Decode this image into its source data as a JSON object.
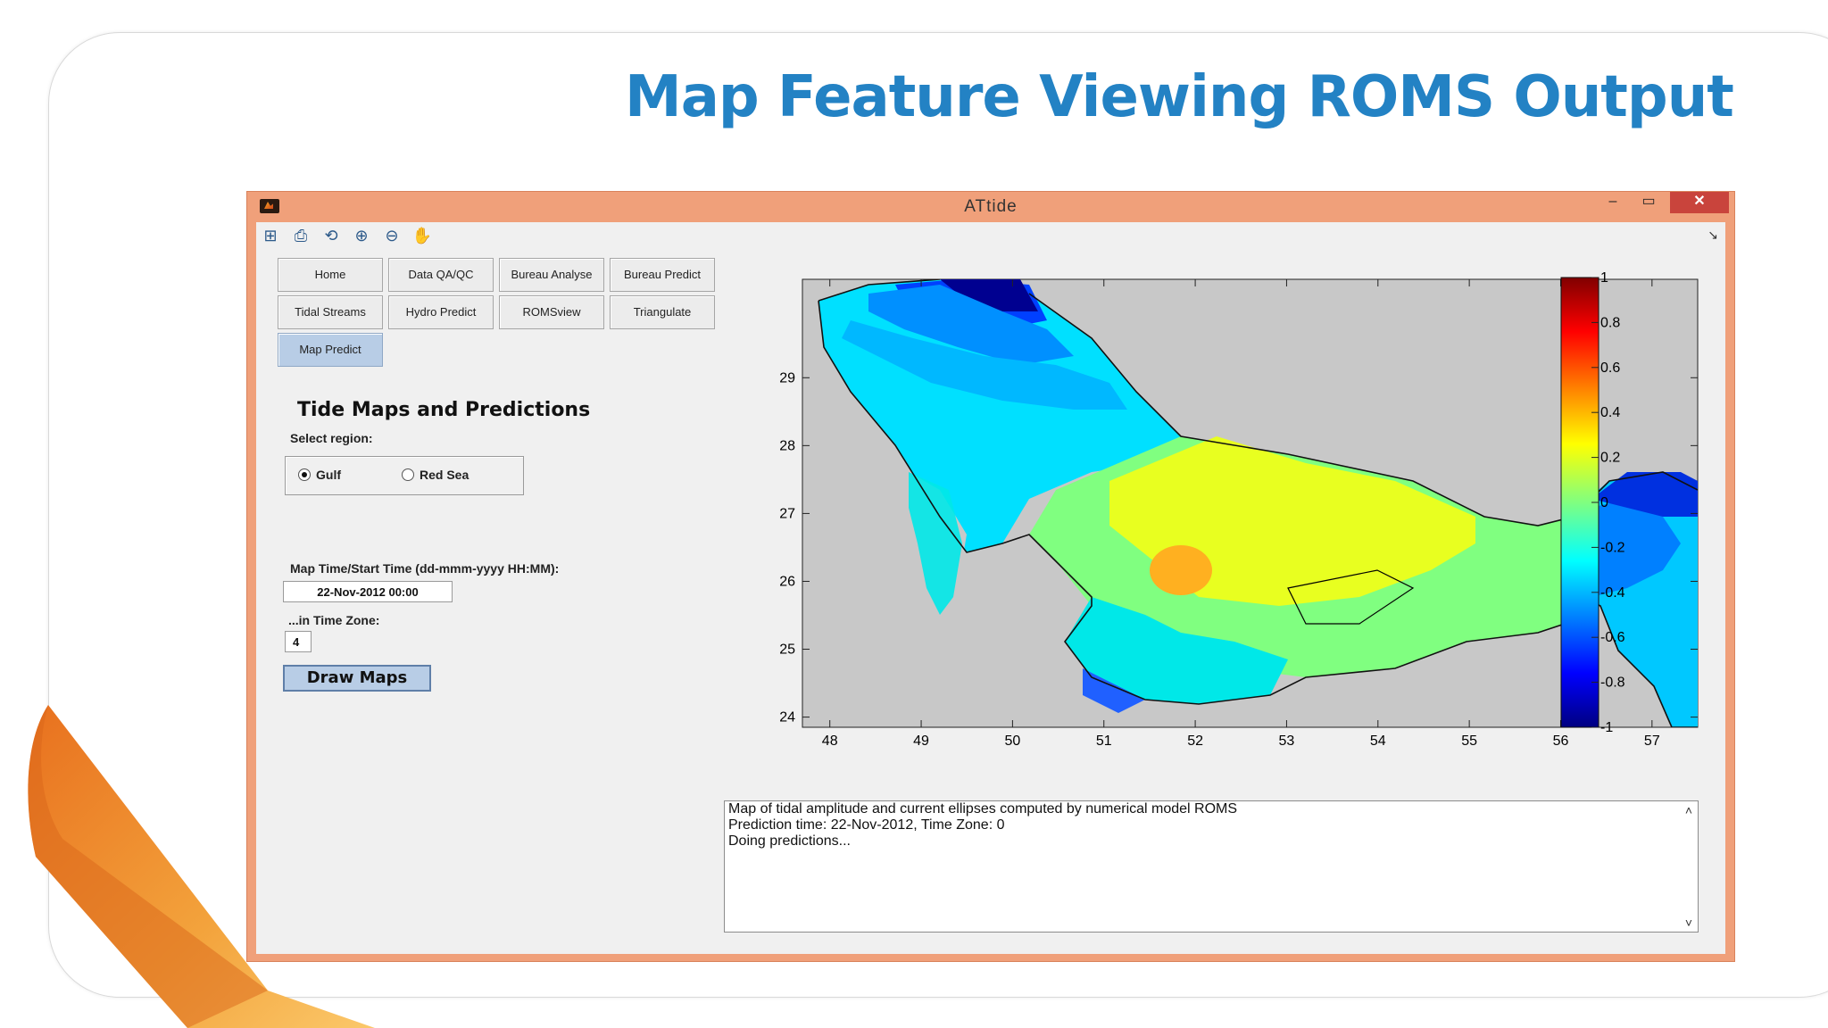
{
  "slide": {
    "title": "Map Feature Viewing ROMS Output"
  },
  "window": {
    "title": "ATtide",
    "minimize": "–",
    "maximize": "▭",
    "close": "✕",
    "dock": "↘"
  },
  "toolbar": {
    "icons": [
      "new-figure-icon",
      "print-icon",
      "rotate-icon",
      "zoom-in-icon",
      "zoom-out-icon",
      "pan-hand-icon"
    ]
  },
  "nav": {
    "buttons": [
      {
        "label": "Home"
      },
      {
        "label": "Data QA/QC"
      },
      {
        "label": "Bureau Analyse"
      },
      {
        "label": "Bureau Predict"
      },
      {
        "label": "Tidal Streams"
      },
      {
        "label": "Hydro Predict"
      },
      {
        "label": "ROMSview"
      },
      {
        "label": "Triangulate"
      },
      {
        "label": "Map Predict",
        "active": true
      }
    ]
  },
  "panel": {
    "title": "Tide Maps and Predictions",
    "region_label": "Select region:",
    "regions": [
      {
        "label": "Gulf",
        "selected": true
      },
      {
        "label": "Red Sea",
        "selected": false
      }
    ],
    "time_label": "Map Time/Start Time (dd-mmm-yyyy HH:MM):",
    "time_value": "22-Nov-2012 00:00",
    "tz_label": "...in Time Zone:",
    "tz_value": "4",
    "draw_button": "Draw Maps"
  },
  "map": {
    "x_ticks": [
      "48",
      "49",
      "50",
      "51",
      "52",
      "53",
      "54",
      "55",
      "56",
      "57"
    ],
    "y_ticks": [
      "24",
      "25",
      "26",
      "27",
      "28",
      "29"
    ],
    "y_ticks_values": [
      24,
      25,
      26,
      27,
      28,
      29
    ],
    "x_range": [
      47.7,
      57.5
    ],
    "y_range": [
      23.85,
      30.45
    ],
    "colorbar_ticks": [
      "1",
      "0.8",
      "0.6",
      "0.4",
      "0.2",
      "0",
      "-0.2",
      "-0.4",
      "-0.6",
      "-0.8",
      "-1"
    ],
    "colorbar_values": [
      1,
      0.8,
      0.6,
      0.4,
      0.2,
      0,
      -0.2,
      -0.4,
      -0.6,
      -0.8,
      -1
    ],
    "land_color": "#c8c8c8"
  },
  "log": {
    "lines": [
      "Map of tidal amplitude and current ellipses computed by numerical model ROMS",
      "Prediction time: 22-Nov-2012, Time Zone: 0",
      "Doing predictions..."
    ],
    "scroll_up": "˄",
    "scroll_down": "˅"
  }
}
